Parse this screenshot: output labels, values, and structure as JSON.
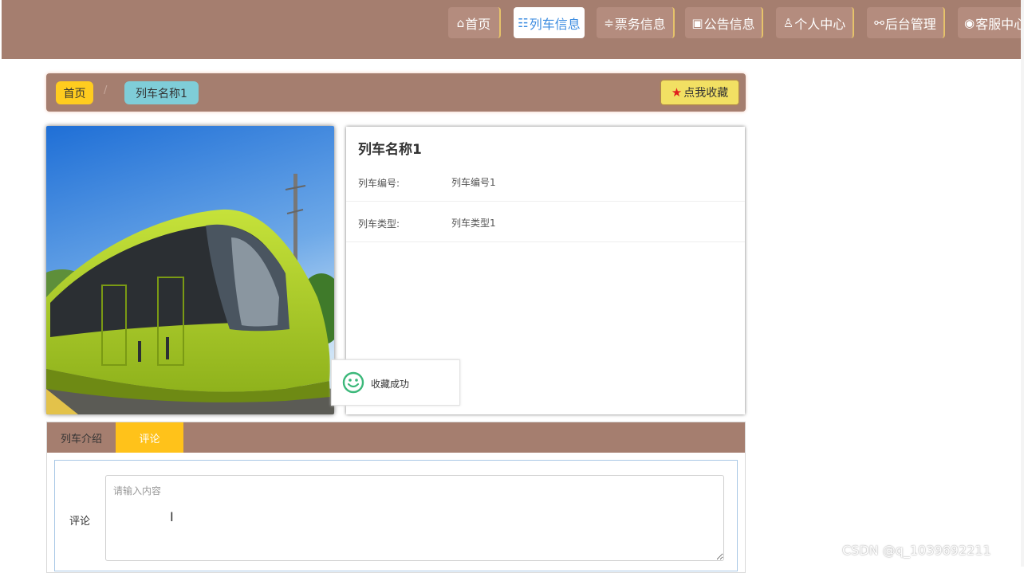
{
  "nav": {
    "items": [
      {
        "icon": "home-icon",
        "glyph": "⌂",
        "label": "首页"
      },
      {
        "icon": "grid-icon",
        "glyph": "☷",
        "label": "列车信息",
        "active": true
      },
      {
        "icon": "sliders-icon",
        "glyph": "≑",
        "label": "票务信息"
      },
      {
        "icon": "gift-icon",
        "glyph": "▣",
        "label": "公告信息"
      },
      {
        "icon": "user-icon",
        "glyph": "♙",
        "label": "个人中心"
      },
      {
        "icon": "link-icon",
        "glyph": "⚯",
        "label": "后台管理"
      },
      {
        "icon": "chat-icon",
        "glyph": "◉",
        "label": "客服中心"
      }
    ]
  },
  "breadcrumb": {
    "home": "首页",
    "separator": "/",
    "current": "列车名称1"
  },
  "favorite": {
    "icon": "star-icon",
    "label": "点我收藏"
  },
  "detail": {
    "title": "列车名称1",
    "rows": [
      {
        "key": "列车编号:",
        "value": "列车编号1"
      },
      {
        "key": "列车类型:",
        "value": "列车类型1"
      }
    ]
  },
  "toast": {
    "icon": "smile-icon",
    "message": "收藏成功"
  },
  "tabs": [
    {
      "label": "列车介绍"
    },
    {
      "label": "评论",
      "active": true
    }
  ],
  "comment": {
    "label": "评论",
    "placeholder": "请输入内容",
    "value": ""
  },
  "watermark": "CSDN @q_1039692211",
  "colors": {
    "header": "#a57e6f",
    "active_nav_text": "#3c8ce0",
    "crumb_home": "#ffcc1f",
    "crumb_current": "#7fcdd8",
    "favorite_button": "#f2e063",
    "active_tab": "#ffc21a"
  }
}
